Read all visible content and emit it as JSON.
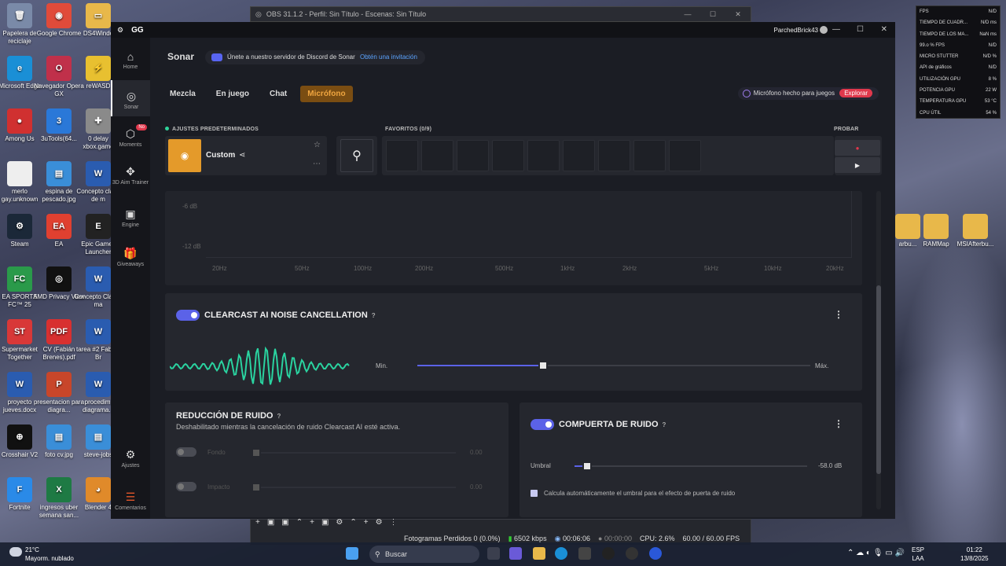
{
  "desktop": {
    "icons": [
      {
        "label": "Papelera de reciclaje",
        "color": "#7a8aa8",
        "glyph": "🗑"
      },
      {
        "label": "Google Chrome",
        "color": "#e04b3a",
        "glyph": "◉"
      },
      {
        "label": "DS4Windo",
        "color": "#e8b84a",
        "glyph": "▭"
      },
      {
        "label": "Microsoft Edge",
        "color": "#1a8fd6",
        "glyph": "e"
      },
      {
        "label": "Navegador Opera GX",
        "color": "#c0304a",
        "glyph": "O"
      },
      {
        "label": "reWASD",
        "color": "#e8c030",
        "glyph": "⚡"
      },
      {
        "label": "Among Us",
        "color": "#d03030",
        "glyph": "●"
      },
      {
        "label": "3uTools(64...",
        "color": "#2a78d8",
        "glyph": "3"
      },
      {
        "label": "0 delay xbox.game",
        "color": "#8a8a8a",
        "glyph": "✚"
      },
      {
        "label": "merlo gay.unknown",
        "color": "#eeeeee",
        "glyph": ""
      },
      {
        "label": "espina de pescado.jpg",
        "color": "#3a8ed8",
        "glyph": "▤"
      },
      {
        "label": "Concepto clave de m",
        "color": "#2a5cb0",
        "glyph": "W"
      },
      {
        "label": "Steam",
        "color": "#1b2838",
        "glyph": "⚙"
      },
      {
        "label": "EA",
        "color": "#e04030",
        "glyph": "EA"
      },
      {
        "label": "Epic Games Launcher",
        "color": "#222222",
        "glyph": "E"
      },
      {
        "label": "EA SPORTS FC™ 25",
        "color": "#2a9a4a",
        "glyph": "FC"
      },
      {
        "label": "AMD Privacy View",
        "color": "#111111",
        "glyph": "◎"
      },
      {
        "label": "Concepto Claves ma",
        "color": "#2a5cb0",
        "glyph": "W"
      },
      {
        "label": "Supermarket Together",
        "color": "#d83838",
        "glyph": "ST"
      },
      {
        "label": "CV (Fabián Brenes).pdf",
        "color": "#d83030",
        "glyph": "PDF"
      },
      {
        "label": "tarea #2 Fabian Br",
        "color": "#2a5cb0",
        "glyph": "W"
      },
      {
        "label": "proyecto jueves.docx",
        "color": "#2a5cb0",
        "glyph": "W"
      },
      {
        "label": "presentacion para diagra...",
        "color": "#c8462a",
        "glyph": "P"
      },
      {
        "label": "procedimi diagrama...",
        "color": "#2a5cb0",
        "glyph": "W"
      },
      {
        "label": "Crosshair V2",
        "color": "#111111",
        "glyph": "⊕"
      },
      {
        "label": "foto cv.jpg",
        "color": "#3a8ed8",
        "glyph": "▤"
      },
      {
        "label": "steve-jobs",
        "color": "#3a8ed8",
        "glyph": "▤"
      },
      {
        "label": "Fortnite",
        "color": "#2a8ae8",
        "glyph": "F"
      },
      {
        "label": "ingresos uber semana san...",
        "color": "#1e7a44",
        "glyph": "X"
      },
      {
        "label": "Blender 4",
        "color": "#e08a2a",
        "glyph": "◕"
      },
      {
        "label": "arbu...",
        "color": "#e8b84a",
        "glyph": ""
      },
      {
        "label": "RAMMap",
        "color": "#e8b84a",
        "glyph": ""
      },
      {
        "label": "MSIAfterbu...",
        "color": "#e8b84a",
        "glyph": ""
      }
    ]
  },
  "obs": {
    "title": "OBS 31.1.2 - Perfil: Sin Título - Escenas: Sin Título",
    "status": {
      "dropped": "Fotogramas Perdidos 0 (0.0%)",
      "kbps": "6502 kbps",
      "rec": "00:06:06",
      "stream": "00:00:00",
      "cpu": "CPU: 2.6%",
      "fps": "60.00 / 60.00 FPS"
    }
  },
  "gg": {
    "title": "GG",
    "user": "ParchedBrick43",
    "sidebar": [
      {
        "label": "Home",
        "glyph": "⌂"
      },
      {
        "label": "Sonar",
        "glyph": "◎"
      },
      {
        "label": "Moments",
        "glyph": "⬡",
        "badge": "No"
      },
      {
        "label": "3D Aim Trainer",
        "glyph": "✥"
      },
      {
        "label": "Engine",
        "glyph": "▣"
      },
      {
        "label": "Giveaways",
        "glyph": "🎁"
      },
      {
        "label": "Ajustes",
        "glyph": "⚙"
      },
      {
        "label": "Comentarios",
        "glyph": "☰"
      }
    ],
    "header": "Sonar",
    "discord_text": "Únete a nuestro servidor de Discord de Sonar",
    "discord_link": "Obtén una invitación",
    "tabs": [
      "Mezcla",
      "En juego",
      "Chat",
      "Micrófono"
    ],
    "mic_promo": "Micrófono hecho para juegos",
    "mic_promo_btn": "Explorar",
    "presets_label": "AJUSTES PREDETERMINADOS",
    "preset_name": "Custom",
    "favs_label": "FAVORITOS (0/9)",
    "test_label": "PROBAR",
    "eq": {
      "ylabels": [
        "-6 dB",
        "-12 dB"
      ],
      "xlabels": [
        "20Hz",
        "50Hz",
        "100Hz",
        "200Hz",
        "500Hz",
        "1kHz",
        "2kHz",
        "5kHz",
        "10kHz",
        "20kHz"
      ]
    },
    "clearcast": {
      "title": "CLEARCAST AI NOISE CANCELLATION",
      "help": "?",
      "min": "Min.",
      "max": "Máx.",
      "level": 0.32
    },
    "noise_reduction": {
      "title": "REDUCCIÓN DE RUIDO",
      "help": "?",
      "subtitle": "Deshabilitado mientras la cancelación de ruido Clearcast AI esté activa.",
      "rows": [
        {
          "label": "Fondo",
          "value": "0.00"
        },
        {
          "label": "Impacto",
          "value": "0.00"
        }
      ]
    },
    "noise_gate": {
      "title": "COMPUERTA DE RUIDO",
      "help": "?",
      "threshold_label": "Umbral",
      "threshold_value": "-58.0 dB",
      "auto_label": "Calcula automáticamente el umbral para el efecto de puerta de ruido"
    }
  },
  "msi": [
    [
      "FPS",
      "N/D"
    ],
    [
      "TIEMPO DE CUADR...",
      "N/D ms"
    ],
    [
      "TIEMPO DE LOS MA...",
      "NaN ms"
    ],
    [
      "99.o % FPS",
      "N/D"
    ],
    [
      "MICRO STUTTER",
      "N/D %"
    ],
    [
      "API de gráficos",
      "N/D"
    ],
    [
      "UTILIZACIÓN GPU",
      "8 %"
    ],
    [
      "POTENCIA GPU",
      "22 W"
    ],
    [
      "TEMPERATURA GPU",
      "53 °C"
    ],
    [
      "CPU ÚTIL",
      "54 %"
    ]
  ],
  "taskbar": {
    "temp": "21°C",
    "weather": "Mayorm. nublado",
    "search": "Buscar",
    "lang": "ESP",
    "layout": "LAA",
    "time": "01:22",
    "date": "13/8/2025"
  }
}
